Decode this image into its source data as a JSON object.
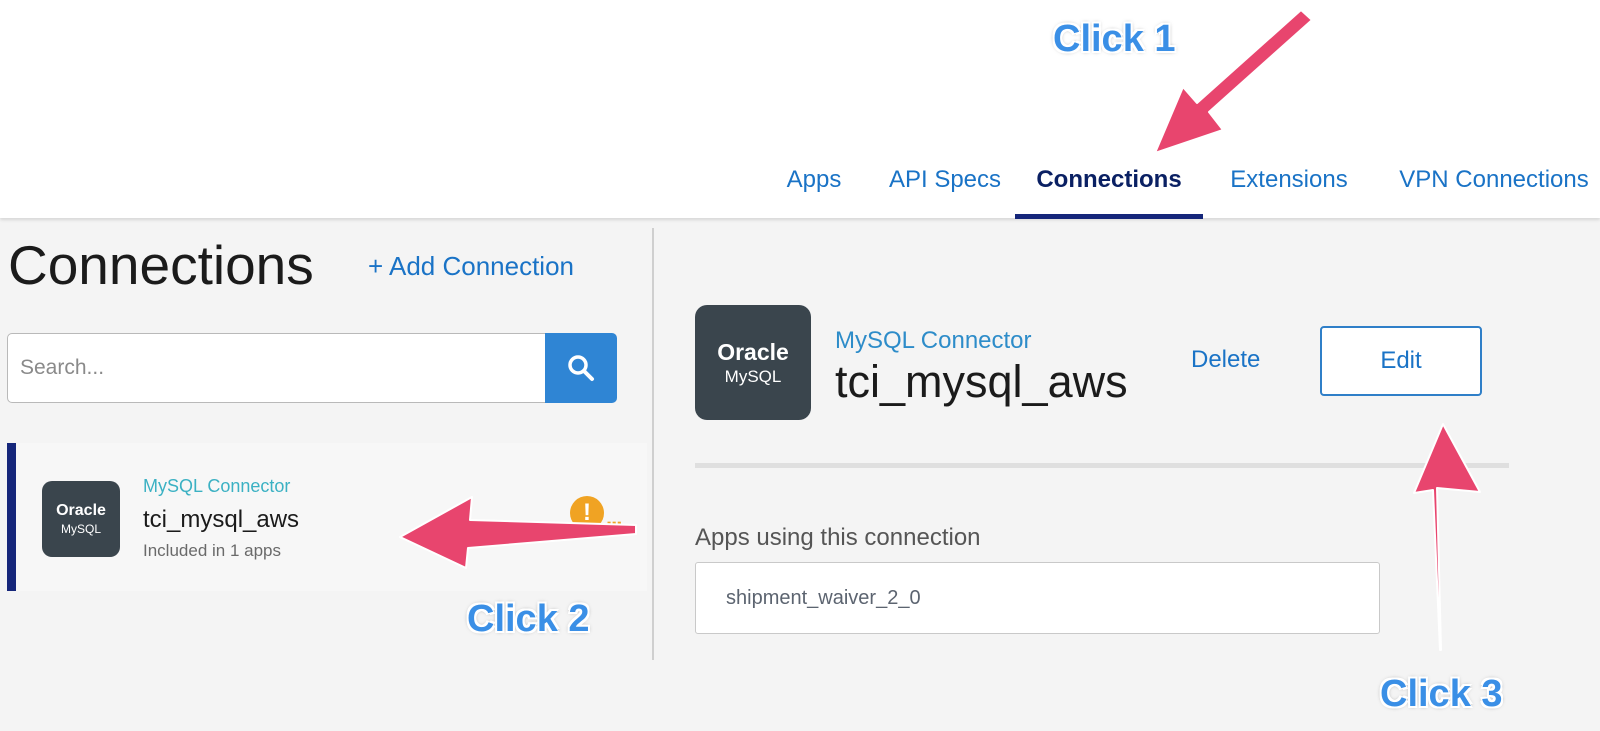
{
  "nav": {
    "tabs": [
      {
        "label": "Apps"
      },
      {
        "label": "API Specs"
      },
      {
        "label": "Connections"
      },
      {
        "label": "Extensions"
      },
      {
        "label": "VPN Connections"
      }
    ],
    "active_tab": "Connections"
  },
  "left_panel": {
    "title": "Connections",
    "add_label": "+ Add Connection",
    "search": {
      "placeholder": "Search...",
      "value": ""
    },
    "items": [
      {
        "type": "MySQL Connector",
        "name": "tci_mysql_aws",
        "subtitle": "Included in 1 apps",
        "logo_line1": "Oracle",
        "logo_line2": "MySQL",
        "warning_glyph": "!",
        "more_glyph": "..."
      }
    ]
  },
  "detail": {
    "logo_line1": "Oracle",
    "logo_line2": "MySQL",
    "type": "MySQL Connector",
    "name": "tci_mysql_aws",
    "delete_label": "Delete",
    "edit_label": "Edit",
    "apps_label": "Apps using this connection",
    "apps": [
      "shipment_waiver_2_0"
    ]
  },
  "annotations": {
    "click1": "Click 1",
    "click2": "Click 2",
    "click3": "Click 3"
  },
  "colors": {
    "accent": "#15267a",
    "link": "#1a73c6",
    "connector_type": "#3bb1c3",
    "warning": "#f0a323",
    "arrow": "#e8456e",
    "annotation_text": "#3a8fe6"
  }
}
